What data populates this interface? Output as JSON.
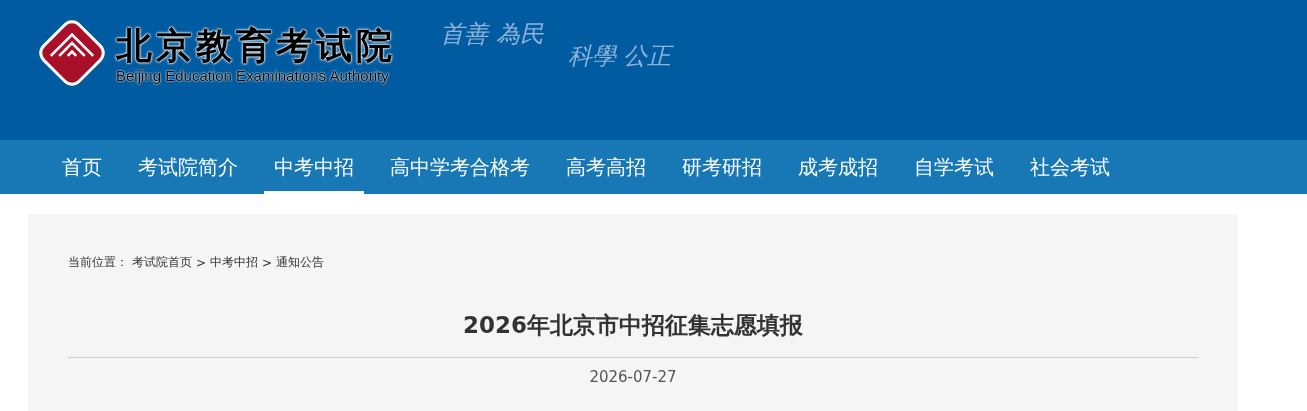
{
  "header": {
    "title": "北京教育考试院",
    "subtitle": "Beijing Education Examinations Authority",
    "mottos": [
      "首善 為民",
      "科學 公正"
    ]
  },
  "nav": [
    {
      "label": "首页",
      "selected": false
    },
    {
      "label": "考试院简介",
      "selected": false
    },
    {
      "label": "中考中招",
      "selected": true
    },
    {
      "label": "高中学考合格考",
      "selected": false
    },
    {
      "label": "高考高招",
      "selected": false
    },
    {
      "label": "研考研招",
      "selected": false
    },
    {
      "label": "成考成招",
      "selected": false
    },
    {
      "label": "自学考试",
      "selected": false
    },
    {
      "label": "社会考试",
      "selected": false
    }
  ],
  "breadcrumb": {
    "label": "当前位置：",
    "items": [
      {
        "text": "考试院首页"
      },
      {
        "separator": ">",
        "text": "中考中招"
      },
      {
        "separator": ">",
        "text": "通知公告"
      }
    ]
  },
  "article": {
    "title": "2026年北京市中招征集志愿填报",
    "date": "2026-07-27"
  }
}
